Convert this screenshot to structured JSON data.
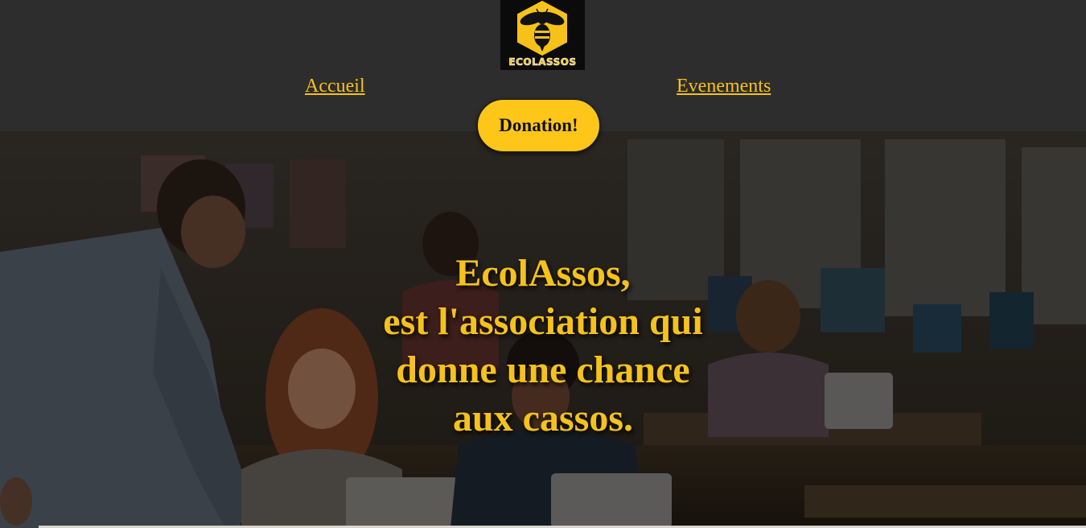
{
  "brand": {
    "logo_text": "ECOLASSOS",
    "logo_icon": "bee-icon",
    "accent_color": "#f6c21a"
  },
  "nav": {
    "accueil": "Accueil",
    "evenements": "Evenements"
  },
  "donate": {
    "label": "Donation!"
  },
  "hero": {
    "image": "classroom-photo",
    "lines": [
      "EcolAssos,",
      "est l'association qui",
      "donne une chance",
      "aux cassos."
    ]
  }
}
